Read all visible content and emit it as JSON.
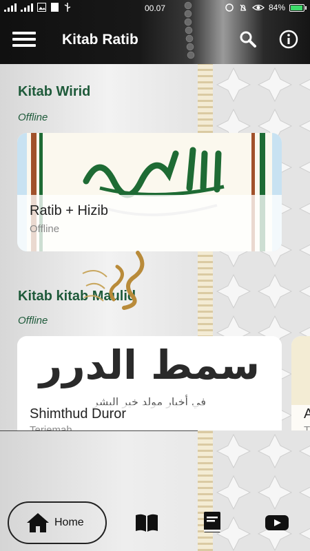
{
  "status_bar": {
    "time": "00.07",
    "battery": "84%",
    "battery_level": 0.84
  },
  "app_bar": {
    "title": "Kitab Ratib",
    "icons": [
      "menu-icon",
      "search-icon",
      "info-icon"
    ]
  },
  "sections": [
    {
      "title": "Kitab Wirid",
      "subtitle": "Offline",
      "cards": [
        {
          "title": "Ratib + Hizib",
          "subtitle": "Offline",
          "art": "ratib-calligraphy"
        }
      ]
    },
    {
      "title": "Kitab kitab Maulid",
      "subtitle": "Offline",
      "cards": [
        {
          "title": "Shimthud Duror",
          "subtitle": "Terjemah",
          "art_text": "سمط الدرر",
          "art_subtext": "في أخبار مولد خير البشر"
        },
        {
          "title": "A",
          "subtitle": "T"
        }
      ]
    }
  ],
  "bottom_nav": {
    "home_label": "Home",
    "items": [
      "home-icon",
      "book-open-icon",
      "book-icon",
      "youtube-icon"
    ]
  },
  "colors": {
    "accent": "#1e5a3a",
    "battery": "#3ddc6a"
  }
}
